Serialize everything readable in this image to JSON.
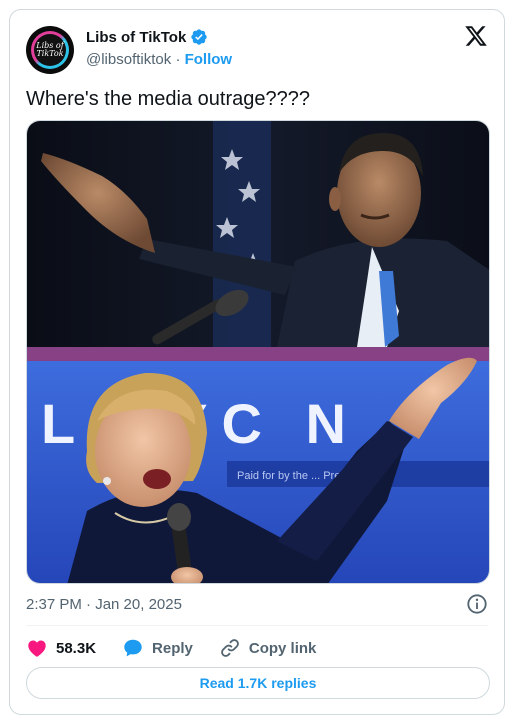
{
  "author": {
    "display_name": "Libs of TikTok",
    "handle": "@libsoftiktok",
    "separator": "·",
    "follow_label": "Follow",
    "avatar_text_line1": "Libs of",
    "avatar_text_line2": "TikTok"
  },
  "tweet": {
    "text": "Where's the media outrage????",
    "timestamp": "2:37 PM · Jan 20, 2025"
  },
  "media": {
    "banner_text": "L RYC N",
    "banner_subtext": "Paid for by the     ... President E"
  },
  "actions": {
    "likes": "58.3K",
    "reply_label": "Reply",
    "copy_link_label": "Copy link",
    "read_replies_label": "Read 1.7K replies"
  },
  "colors": {
    "accent": "#1d9bf0",
    "like": "#f91880",
    "secondary_text": "#536471",
    "border": "#cfd9de"
  }
}
